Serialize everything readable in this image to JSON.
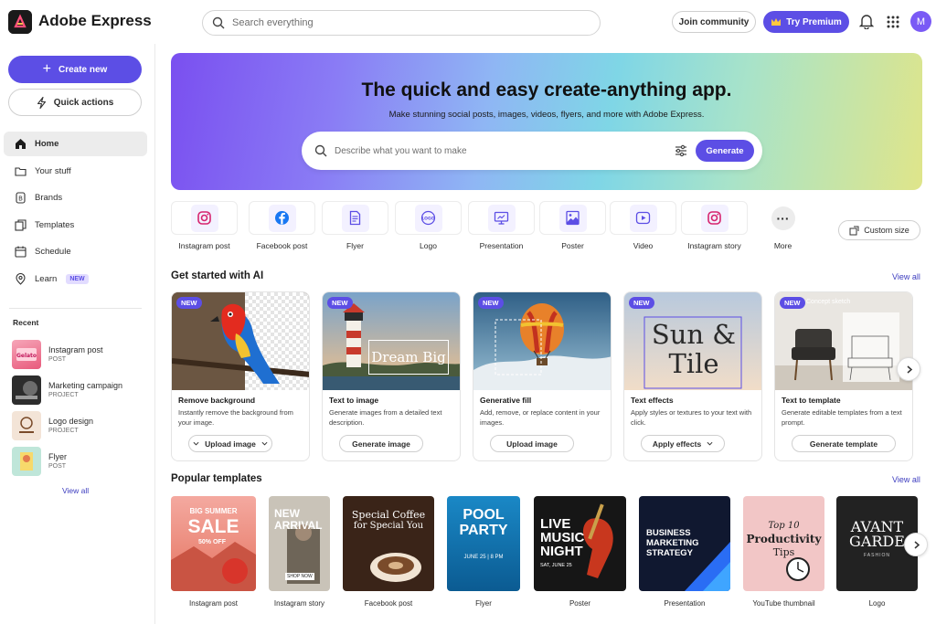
{
  "app": {
    "title": "Adobe Express",
    "avatar_initial": "M"
  },
  "topbar": {
    "search_placeholder": "Search everything",
    "join_label": "Join community",
    "premium_label": "Try Premium"
  },
  "sidebar": {
    "create_label": "Create new",
    "quick_label": "Quick actions",
    "nav": [
      {
        "label": "Home",
        "icon": "home-icon",
        "active": true
      },
      {
        "label": "Your stuff",
        "icon": "folder-icon"
      },
      {
        "label": "Brands",
        "icon": "brand-icon"
      },
      {
        "label": "Templates",
        "icon": "templates-icon"
      },
      {
        "label": "Schedule",
        "icon": "calendar-icon"
      },
      {
        "label": "Learn",
        "icon": "learn-icon",
        "badge": "NEW"
      }
    ],
    "recent_label": "Recent",
    "recent": [
      {
        "name": "Instagram post",
        "type": "POST"
      },
      {
        "name": "Marketing campaign",
        "type": "PROJECT"
      },
      {
        "name": "Logo design",
        "type": "PROJECT"
      },
      {
        "name": "Flyer",
        "type": "POST"
      }
    ],
    "view_all": "View all"
  },
  "hero": {
    "title": "The quick and easy create-anything app.",
    "subtitle": "Make stunning social posts, images, videos, flyers, and more with Adobe Express.",
    "input_placeholder": "Describe what you want to make",
    "generate_label": "Generate"
  },
  "tiles": [
    {
      "label": "Instagram post",
      "icon": "instagram-icon"
    },
    {
      "label": "Facebook post",
      "icon": "facebook-icon"
    },
    {
      "label": "Flyer",
      "icon": "flyer-icon"
    },
    {
      "label": "Logo",
      "icon": "logo-icon"
    },
    {
      "label": "Presentation",
      "icon": "presentation-icon"
    },
    {
      "label": "Poster",
      "icon": "poster-icon"
    },
    {
      "label": "Video",
      "icon": "video-icon"
    },
    {
      "label": "Instagram story",
      "icon": "instagram-icon"
    },
    {
      "label": "More",
      "icon": "more-icon"
    }
  ],
  "custom_size_label": "Custom size",
  "ai_section": {
    "title": "Get started with AI",
    "view_all": "View all",
    "new_tag": "NEW",
    "cards": [
      {
        "title": "Remove background",
        "desc": "Instantly remove the background from your image.",
        "button": "Upload image"
      },
      {
        "title": "Text to image",
        "desc": "Generate images from a detailed text description.",
        "button": "Generate image",
        "overlay": "Dream Big"
      },
      {
        "title": "Generative fill",
        "desc": "Add, remove, or replace content in your images.",
        "button": "Upload image"
      },
      {
        "title": "Text effects",
        "desc": "Apply styles or textures to your text with click.",
        "button": "Apply effects",
        "overlay": "Sun & Tile"
      },
      {
        "title": "Text to template",
        "desc": "Generate editable templates from a text prompt.",
        "button": "Generate template",
        "overlay": "Concept sketch"
      }
    ]
  },
  "templates_section": {
    "title": "Popular templates",
    "view_all": "View all",
    "items": [
      {
        "label": "Instagram post",
        "text1": "BIG SUMMER",
        "text2": "SALE",
        "text3": "50% OFF"
      },
      {
        "label": "Instagram story",
        "text1": "NEW",
        "text2": "ARRIVAL",
        "text3": "SHOP NOW"
      },
      {
        "label": "Facebook post",
        "text1": "Special Coffee",
        "text2": "for Special You"
      },
      {
        "label": "Flyer",
        "text1": "POOL",
        "text2": "PARTY",
        "text3": "JUNE 25 | 8 PM"
      },
      {
        "label": "Poster",
        "text1": "LIVE",
        "text2": "MUSIC",
        "text3": "NIGHT",
        "text4": "SAT, JUNE 25"
      },
      {
        "label": "Presentation",
        "text1": "BUSINESS",
        "text2": "MARKETING",
        "text3": "STRATEGY"
      },
      {
        "label": "YouTube thumbnail",
        "text1": "Top 10",
        "text2": "Productivity",
        "text3": "Tips"
      },
      {
        "label": "Logo",
        "text1": "AVANT",
        "text2": "GARDE",
        "text3": "FASHION"
      }
    ]
  },
  "colors": {
    "accent": "#5c4ee5",
    "link": "#3d3dbf"
  }
}
